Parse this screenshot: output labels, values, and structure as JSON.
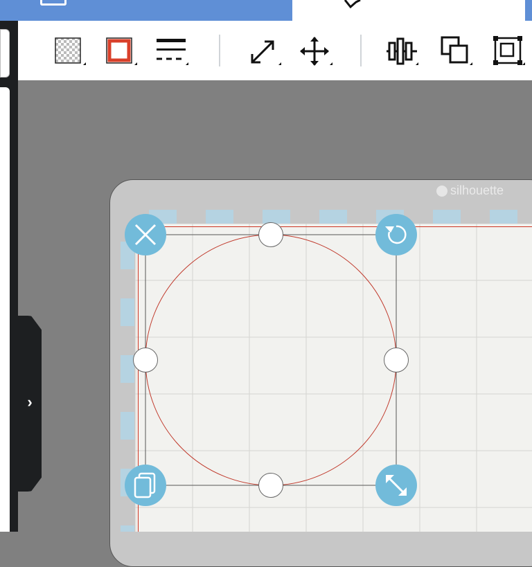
{
  "window": {
    "title_tab_icon": "pen-icon"
  },
  "toolbar": {
    "fill_icon": "transparent-fill-icon",
    "line_color_icon": "line-color-icon",
    "line_style_icon": "line-style-icon",
    "scale_icon": "scale-arrow-icon",
    "move_icon": "move-icon",
    "align_icon": "align-icon",
    "arrange_icon": "arrange-icon",
    "group_icon": "group-icon",
    "accent_color": "#d9402a"
  },
  "sidebar": {
    "expander_label": "›"
  },
  "mat": {
    "brand": "silhouette"
  },
  "selection": {
    "shape": "circle",
    "delete_icon": "close-icon",
    "rotate_icon": "rotate-icon",
    "duplicate_icon": "duplicate-icon",
    "resize_icon": "resize-icon",
    "handle_color": "#72bbda",
    "shape_stroke": "#c0392b"
  }
}
